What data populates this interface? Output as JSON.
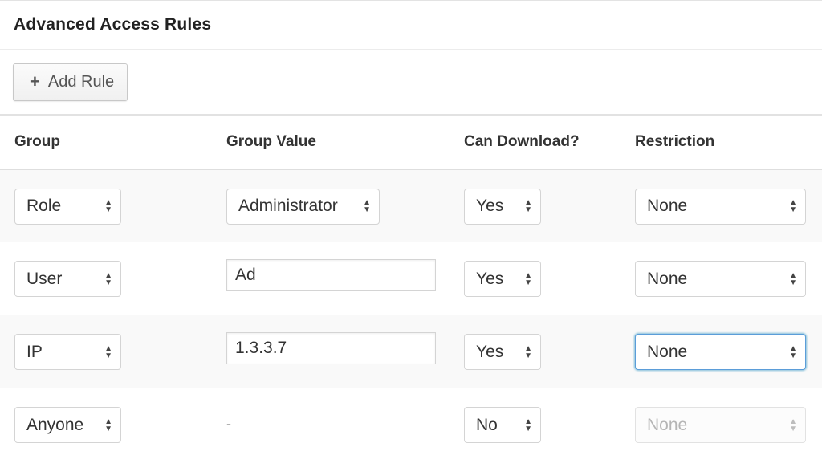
{
  "panel": {
    "title": "Advanced Access Rules"
  },
  "toolbar": {
    "add_icon": "plus-icon",
    "add_label": "Add Rule"
  },
  "table": {
    "headers": [
      "Group",
      "Group Value",
      "Can Download?",
      "Restriction"
    ],
    "rows": [
      {
        "group": "Role",
        "group_value": {
          "type": "select",
          "value": "Administrator"
        },
        "can_download": "Yes",
        "restriction": {
          "value": "None",
          "state": "normal"
        }
      },
      {
        "group": "User",
        "group_value": {
          "type": "text",
          "value": "Ad"
        },
        "can_download": "Yes",
        "restriction": {
          "value": "None",
          "state": "normal"
        }
      },
      {
        "group": "IP",
        "group_value": {
          "type": "text",
          "value": "1.3.3.7"
        },
        "can_download": "Yes",
        "restriction": {
          "value": "None",
          "state": "focused"
        }
      },
      {
        "group": "Anyone",
        "group_value": {
          "type": "none",
          "value": "-"
        },
        "can_download": "No",
        "restriction": {
          "value": "None",
          "state": "disabled"
        }
      }
    ]
  },
  "icons": {
    "select_arrows": "up-down-arrows-icon"
  },
  "colors": {
    "focus_ring": "#5b9dd9",
    "row_stripe": "#f9f9f9"
  }
}
